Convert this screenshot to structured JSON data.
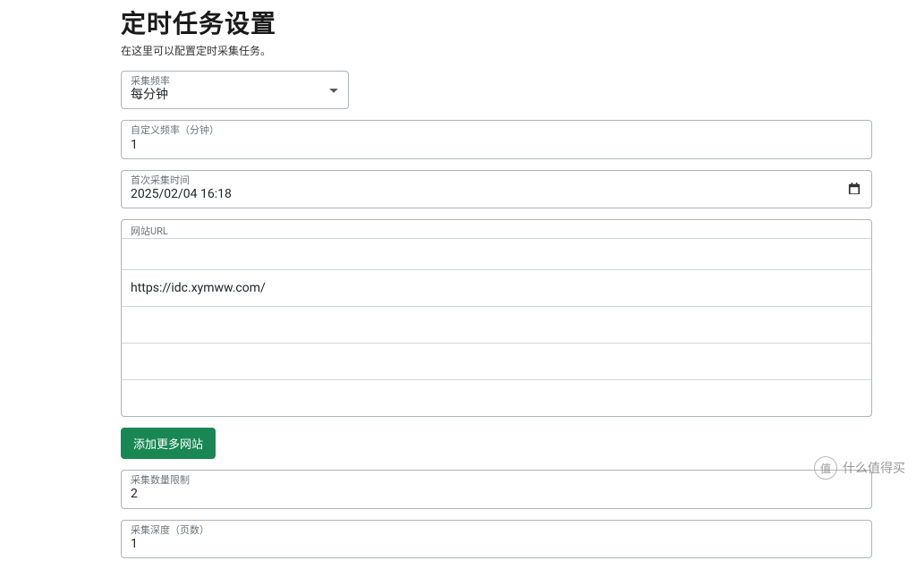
{
  "header": {
    "title": "定时任务设置",
    "subtitle": "在这里可以配置定时采集任务。"
  },
  "form": {
    "frequency": {
      "label": "采集频率",
      "value": "每分钟"
    },
    "customFrequency": {
      "label": "自定义频率（分钟）",
      "value": "1"
    },
    "firstCollectTime": {
      "label": "首次采集时间",
      "value": "2025/02/04 16:18"
    },
    "urls": {
      "label": "网站URL",
      "items": [
        "",
        "https://idc.xymww.com/",
        "",
        "",
        ""
      ]
    },
    "addMoreLabel": "添加更多网站",
    "collectLimit": {
      "label": "采集数量限制",
      "value": "2"
    },
    "collectDepth": {
      "label": "采集深度（页数）",
      "value": "1"
    }
  },
  "watermark": {
    "logoText": "值",
    "text": "什么值得买"
  }
}
